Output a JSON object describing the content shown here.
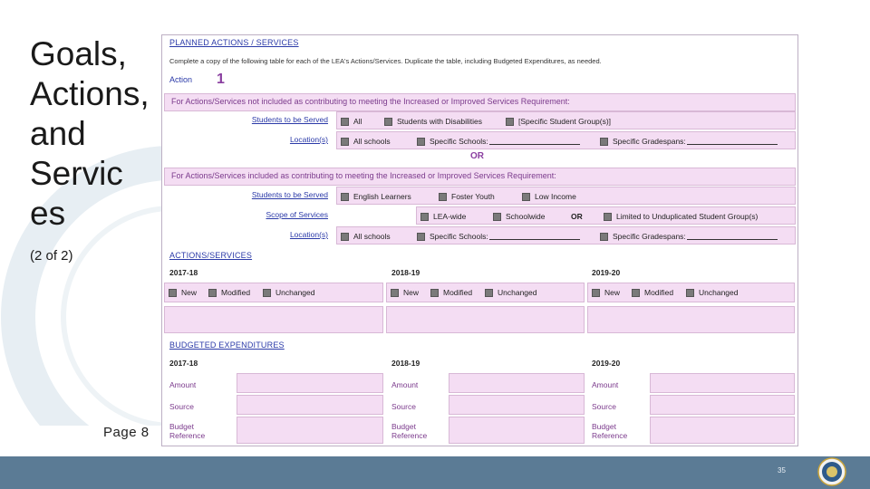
{
  "slide": {
    "title": "Goals,\nActions,\nand\nServic\nes",
    "subtitle": "(2 of 2)",
    "page_ref": "Page 8",
    "slide_number": "35",
    "colors": {
      "footer": "#5b7b95",
      "accent_purple": "#7b3a8c",
      "link_blue": "#2b3aa8",
      "band_pink": "#f4ddf3"
    }
  },
  "form": {
    "planned_title": "PLANNED ACTIONS / SERVICES",
    "instruction": "Complete a copy of the following table for each of the LEA's Actions/Services. Duplicate the table, including Budgeted Expenditures, as needed.",
    "action_label": "Action",
    "action_number": "1",
    "non_contrib_band": "For Actions/Services not included as contributing to meeting the Increased or Improved Services Requirement:",
    "students_label": "Students to be Served",
    "students_opts": [
      "All",
      "Students with Disabilities",
      "[Specific Student Group(s)]"
    ],
    "location_label": "Location(s)",
    "location_opts": [
      "All schools",
      "Specific Schools:",
      "Specific Gradespans:"
    ],
    "or_label": "OR",
    "contrib_band": "For Actions/Services included as contributing to meeting the Increased or Improved Services Requirement:",
    "contrib_students_opts": [
      "English Learners",
      "Foster Youth",
      "Low Income"
    ],
    "scope_label": "Scope of Services",
    "scope_opts": [
      "LEA-wide",
      "Schoolwide",
      "OR",
      "Limited to Unduplicated Student Group(s)"
    ],
    "actions_title": "ACTIONS/SERVICES",
    "years": [
      "2017-18",
      "2018-19",
      "2019-20"
    ],
    "status_opts": [
      "New",
      "Modified",
      "Unchanged"
    ],
    "budget_title": "BUDGETED EXPENDITURES",
    "budget_rows": [
      "Amount",
      "Source",
      "Budget\nReference"
    ]
  }
}
